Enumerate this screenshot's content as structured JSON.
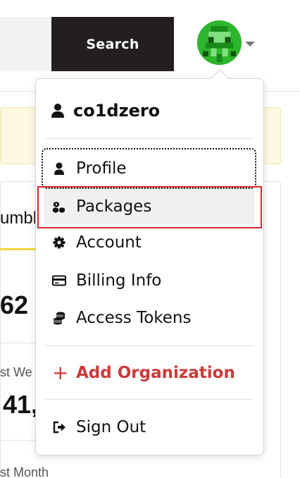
{
  "header": {
    "search_button_label": "Search",
    "avatar_icon": "pixel-avatar-icon",
    "caret_icon": "caret-down-icon"
  },
  "background": {
    "tab_fragment": "umbl",
    "stat_fragment_1": "62",
    "label_fragment_1": "st We",
    "stat_fragment_2": "41,",
    "label_fragment_2": "st Month",
    "accent_color": "#f3d63a",
    "notice_color": "#fff8e1"
  },
  "menu": {
    "username": "co1dzero",
    "items": [
      {
        "label": "Profile",
        "icon": "user-icon"
      },
      {
        "label": "Packages",
        "icon": "cubes-icon"
      },
      {
        "label": "Account",
        "icon": "gear-icon"
      },
      {
        "label": "Billing Info",
        "icon": "credit-card-icon"
      },
      {
        "label": "Access Tokens",
        "icon": "coins-icon"
      }
    ],
    "add_org": {
      "label": "Add Organization",
      "icon": "plus-icon",
      "color": "#c93a3a"
    },
    "sign_out": {
      "label": "Sign Out",
      "icon": "sign-out-icon"
    },
    "highlight_color": "#d42a2a"
  }
}
